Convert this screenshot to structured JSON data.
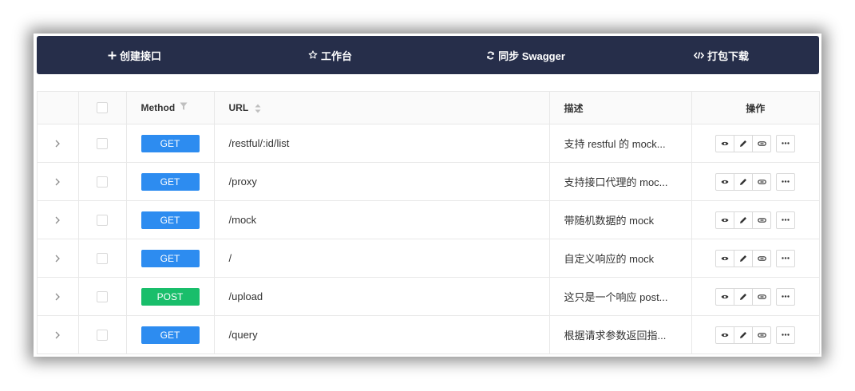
{
  "toolbar": {
    "create_label": "创建接口",
    "workbench_label": "工作台",
    "sync_label": "同步 Swagger",
    "download_label": "打包下载"
  },
  "table": {
    "headers": {
      "method": "Method",
      "url": "URL",
      "desc": "描述",
      "ops": "操作"
    },
    "rows": [
      {
        "method": "GET",
        "method_color": "#2d8cf0",
        "url": "/restful/:id/list",
        "desc": "支持 restful 的 mock..."
      },
      {
        "method": "GET",
        "method_color": "#2d8cf0",
        "url": "/proxy",
        "desc": "支持接口代理的 moc..."
      },
      {
        "method": "GET",
        "method_color": "#2d8cf0",
        "url": "/mock",
        "desc": "带随机数据的 mock"
      },
      {
        "method": "GET",
        "method_color": "#2d8cf0",
        "url": "/",
        "desc": "自定义响应的 mock"
      },
      {
        "method": "POST",
        "method_color": "#19be6b",
        "url": "/upload",
        "desc": "这只是一个响应 post..."
      },
      {
        "method": "GET",
        "method_color": "#2d8cf0",
        "url": "/query",
        "desc": "根据请求参数返回指..."
      }
    ]
  },
  "colors": {
    "toolbar_bg": "#262e4a",
    "get": "#2d8cf0",
    "post": "#19be6b"
  }
}
